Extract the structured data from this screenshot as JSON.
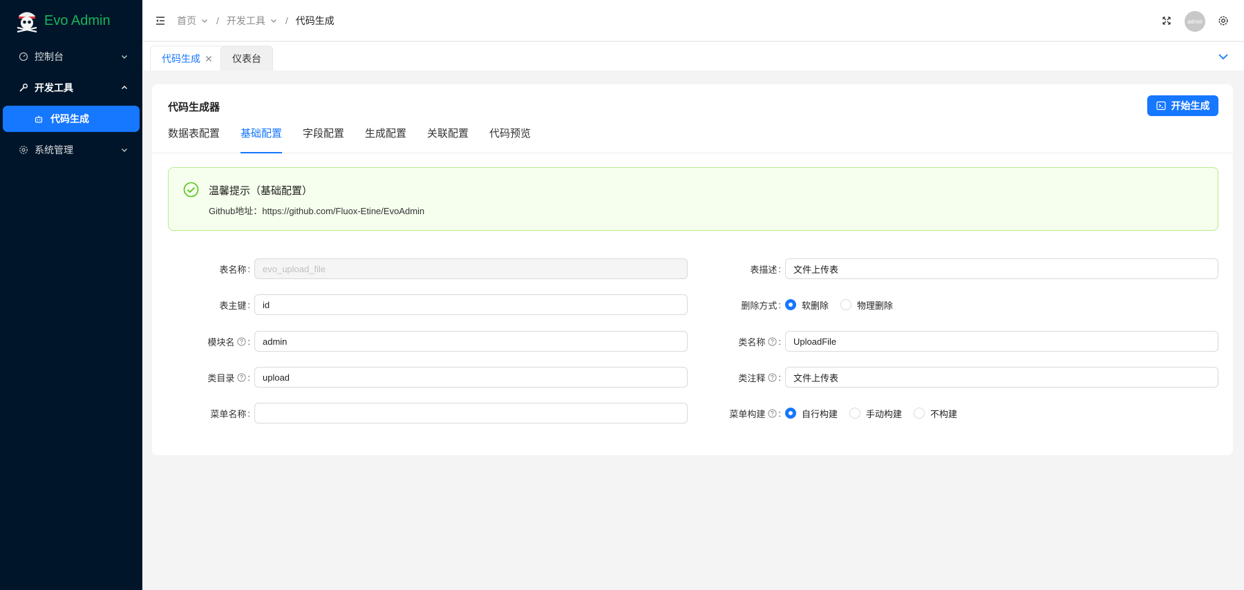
{
  "app": {
    "title": "Evo Admin"
  },
  "colors": {
    "primary": "#1677ff",
    "sidebar_bg": "#001529",
    "logo_green": "#16b65a",
    "alert_bg": "#f6ffed",
    "alert_border": "#b7eb8f",
    "alert_icon": "#52c41a"
  },
  "sidebar": {
    "items": [
      {
        "label": "控制台",
        "icon": "dashboard-icon",
        "expanded": false
      },
      {
        "label": "开发工具",
        "icon": "tool-icon",
        "expanded": true,
        "children": [
          {
            "label": "代码生成",
            "icon": "robot-icon",
            "active": true
          }
        ]
      },
      {
        "label": "系统管理",
        "icon": "gear-icon",
        "expanded": false
      }
    ]
  },
  "header": {
    "breadcrumb": [
      "首页",
      "开发工具",
      "代码生成"
    ],
    "avatar_text": "admin"
  },
  "page_tabs": [
    {
      "label": "代码生成",
      "active": true,
      "closable": true
    },
    {
      "label": "仪表台",
      "active": false,
      "closable": false
    }
  ],
  "card": {
    "title": "代码生成器",
    "generate_button": "开始生成",
    "tabs": [
      "数据表配置",
      "基础配置",
      "字段配置",
      "生成配置",
      "关联配置",
      "代码预览"
    ],
    "active_tab": "基础配置",
    "alert": {
      "title": "温馨提示（基础配置）",
      "desc_label": "Github地址：",
      "desc_url": "https://github.com/Fluox-Etine/EvoAdmin"
    }
  },
  "form": {
    "table_name": {
      "label": "表名称",
      "value": "evo_upload_file",
      "disabled": true
    },
    "table_desc": {
      "label": "表描述",
      "value": "文件上传表"
    },
    "primary_key": {
      "label": "表主键",
      "value": "id"
    },
    "delete_mode": {
      "label": "删除方式",
      "options": [
        "软删除",
        "物理删除"
      ],
      "selected": "软删除"
    },
    "module_name": {
      "label": "模块名",
      "value": "admin"
    },
    "class_name": {
      "label": "类名称",
      "value": "UploadFile"
    },
    "class_dir": {
      "label": "类目录",
      "value": "upload"
    },
    "class_comment": {
      "label": "类注释",
      "value": "文件上传表"
    },
    "menu_name": {
      "label": "菜单名称",
      "value": ""
    },
    "menu_build": {
      "label": "菜单构建",
      "options": [
        "自行构建",
        "手动构建",
        "不构建"
      ],
      "selected": "自行构建"
    }
  }
}
